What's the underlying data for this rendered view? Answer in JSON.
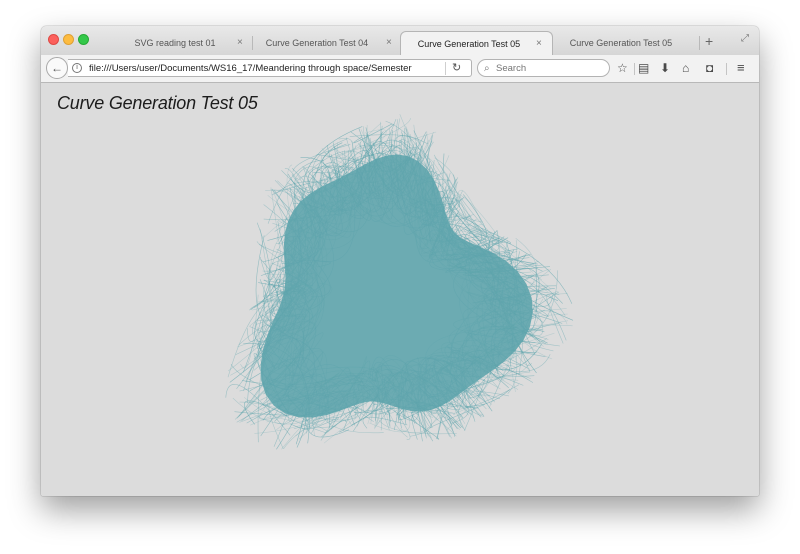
{
  "window": {
    "tabs": [
      {
        "label": "SVG reading test 01",
        "active": false
      },
      {
        "label": "Curve Generation Test 04",
        "active": false
      },
      {
        "label": "Curve Generation Test 05",
        "active": true
      },
      {
        "label": "Curve Generation Test 05",
        "active": false
      }
    ],
    "close_glyph": "×",
    "newtab_glyph": "+"
  },
  "navbar": {
    "url": "file:///Users/user/Documents/WS16_17/Meandering through space/Semester",
    "search_placeholder": "Search"
  },
  "page": {
    "title": "Curve Generation Test 05",
    "curve_color": "#5fa5ad",
    "background": "#dcdcdc"
  }
}
